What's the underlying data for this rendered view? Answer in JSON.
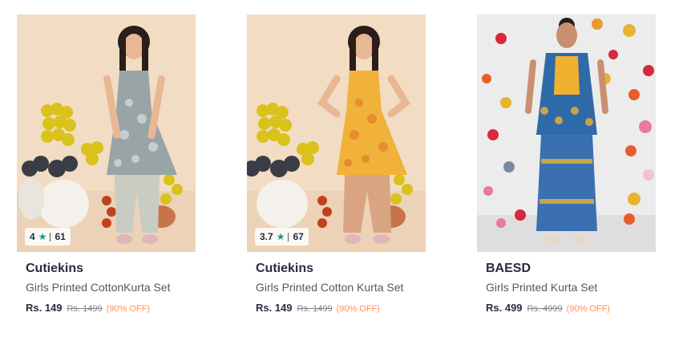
{
  "products": [
    {
      "brand": "Cutiekins",
      "title": "Girls Printed CottonKurta Set",
      "price": "Rs. 149",
      "mrp": "Rs. 1499",
      "discount": "(90% OFF)",
      "rating": "4",
      "rating_count": "61",
      "image_icon": "product-photo-grey-floral-kurta-set"
    },
    {
      "brand": "Cutiekins",
      "title": "Girls Printed Cotton Kurta Set",
      "price": "Rs. 149",
      "mrp": "Rs. 1499",
      "discount": "(90% OFF)",
      "rating": "3.7",
      "rating_count": "67",
      "image_icon": "product-photo-yellow-floral-kurta-set"
    },
    {
      "brand": "BAESD",
      "title": "Girls Printed Kurta Set",
      "price": "Rs. 499",
      "mrp": "Rs. 4999",
      "discount": "(90% OFF)",
      "image_icon": "product-photo-blue-printed-kurta-set"
    }
  ],
  "colors": {
    "rating_star": "#14958f",
    "discount": "#ff905a",
    "brand_text": "#282c3f",
    "title_text": "#535766",
    "mrp_text": "#7e818c"
  },
  "star_icon": "star-icon"
}
